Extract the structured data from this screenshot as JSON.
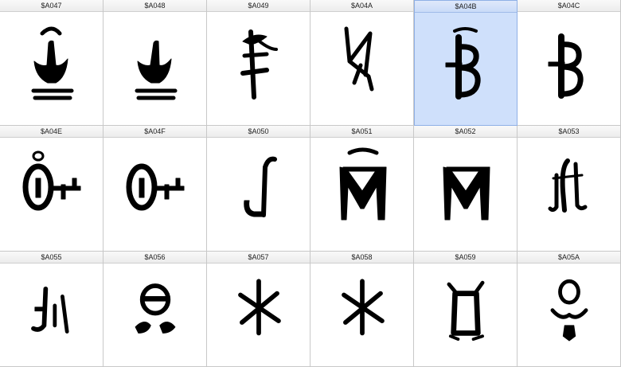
{
  "window": {
    "columns": 6,
    "rows": 3
  },
  "cells": [
    {
      "code": "$A047",
      "selected": false
    },
    {
      "code": "$A048",
      "selected": false
    },
    {
      "code": "$A049",
      "selected": false
    },
    {
      "code": "$A04A",
      "selected": false
    },
    {
      "code": "$A04B",
      "selected": true
    },
    {
      "code": "$A04C",
      "selected": false
    },
    {
      "code": "$A04E",
      "selected": false
    },
    {
      "code": "$A04F",
      "selected": false
    },
    {
      "code": "$A050",
      "selected": false
    },
    {
      "code": "$A051",
      "selected": false
    },
    {
      "code": "$A052",
      "selected": false
    },
    {
      "code": "$A053",
      "selected": false
    },
    {
      "code": "$A055",
      "selected": false
    },
    {
      "code": "$A056",
      "selected": false
    },
    {
      "code": "$A057",
      "selected": false
    },
    {
      "code": "$A058",
      "selected": false
    },
    {
      "code": "$A059",
      "selected": false
    },
    {
      "code": "$A05A",
      "selected": false
    }
  ],
  "colors": {
    "selection": "#cfe0fb",
    "selection_border": "#8fb0e6",
    "grid_line": "#c8c8c8",
    "glyph": "#000000"
  }
}
